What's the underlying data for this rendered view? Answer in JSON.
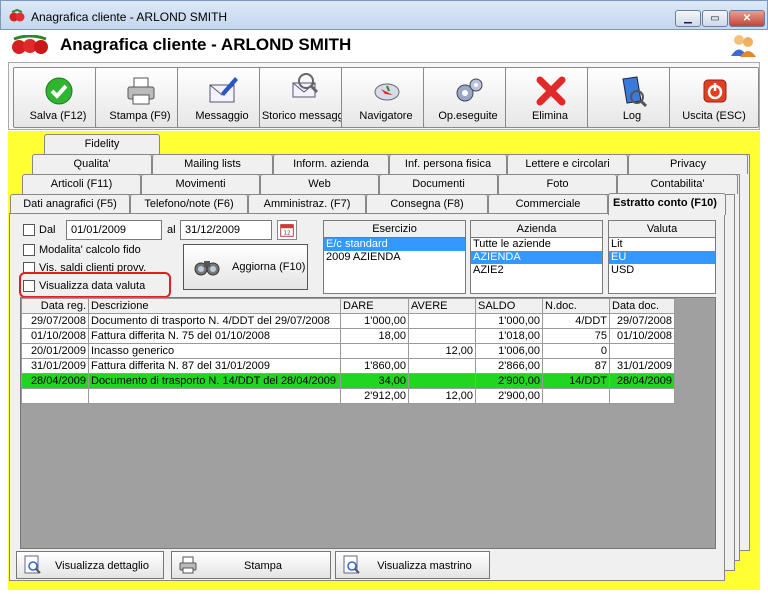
{
  "window": {
    "title": "Anagrafica cliente - ARLOND SMITH",
    "min_label": "▁",
    "max_label": "▭",
    "close_label": "✕"
  },
  "header": {
    "title": "Anagrafica cliente - ARLOND SMITH"
  },
  "toolbar": {
    "buttons": [
      {
        "label": "Salva (F12)",
        "icon": "check-icon"
      },
      {
        "label": "Stampa (F9)",
        "icon": "printer-icon"
      },
      {
        "label": "Messaggio",
        "icon": "envelope-pen-icon"
      },
      {
        "label": "Storico messaggi",
        "icon": "message-history-icon"
      },
      {
        "label": "Navigatore",
        "icon": "compass-icon"
      },
      {
        "label": "Op.eseguite",
        "icon": "gears-icon"
      },
      {
        "label": "Elimina",
        "icon": "delete-x-icon"
      },
      {
        "label": "Log",
        "icon": "log-book-icon"
      },
      {
        "label": "Uscita (ESC)",
        "icon": "exit-icon"
      }
    ]
  },
  "tabs": {
    "row1": [
      "Fidelity"
    ],
    "row2": [
      "Qualita'",
      "Mailing lists",
      "Inform. azienda",
      "Inf. persona fisica",
      "Lettere e circolari",
      "Privacy"
    ],
    "row3": [
      "Articoli (F11)",
      "Movimenti",
      "Web",
      "Documenti",
      "Foto",
      "Contabilita'"
    ],
    "row4": [
      "Dati anagrafici (F5)",
      "Telefono/note (F6)",
      "Amministraz. (F7)",
      "Consegna (F8)",
      "Commerciale",
      "Estratto conto (F10)"
    ]
  },
  "filters": {
    "dal_label": "Dal",
    "dal_value": "01/01/2009",
    "al_label": "al",
    "al_value": "31/12/2009",
    "chk_calcolo": "Modalita' calcolo fido",
    "chk_saldi": "Vis. saldi clienti provv.",
    "chk_valuta": "Visualizza data valuta",
    "aggiorna_label": "Aggiorna (F10)"
  },
  "lists": {
    "esercizio": {
      "header": "Esercizio",
      "items": [
        "E/c standard",
        "2009 AZIENDA"
      ],
      "selected": 0
    },
    "azienda": {
      "header": "Azienda",
      "items": [
        "Tutte le aziende",
        "AZIENDA",
        "AZIE2"
      ],
      "selected": 1
    },
    "valuta": {
      "header": "Valuta",
      "items": [
        "Lit",
        "EU",
        "USD"
      ],
      "selected": 1
    }
  },
  "grid": {
    "columns": [
      "Data reg.",
      "Descrizione",
      "DARE",
      "AVERE",
      "SALDO",
      "N.doc.",
      "Data doc."
    ],
    "rows": [
      [
        "29/07/2008",
        "Documento di trasporto N. 4/DDT del 29/07/2008",
        "1'000,00",
        "",
        "1'000,00",
        "4/DDT",
        "29/07/2008"
      ],
      [
        "01/10/2008",
        "Fattura differita N. 75 del 01/10/2008",
        "18,00",
        "",
        "1'018,00",
        "75",
        "01/10/2008"
      ],
      [
        "20/01/2009",
        "Incasso generico",
        "",
        "12,00",
        "1'006,00",
        "0",
        ""
      ],
      [
        "31/01/2009",
        "Fattura differita N. 87 del 31/01/2009",
        "1'860,00",
        "",
        "2'866,00",
        "87",
        "31/01/2009"
      ],
      [
        "28/04/2009",
        "Documento di trasporto N. 14/DDT del 28/04/2009",
        "34,00",
        "",
        "2'900,00",
        "14/DDT",
        "28/04/2009"
      ]
    ],
    "highlight_row": 4,
    "totals": [
      "",
      "",
      "2'912,00",
      "12,00",
      "2'900,00",
      "",
      ""
    ]
  },
  "bottom_buttons": {
    "dettaglio": "Visualizza dettaglio",
    "stampa": "Stampa",
    "mastrino": "Visualizza mastrino"
  },
  "colors": {
    "panel": "#ffff33",
    "highlight": "#21d621",
    "selection": "#3399ff"
  }
}
